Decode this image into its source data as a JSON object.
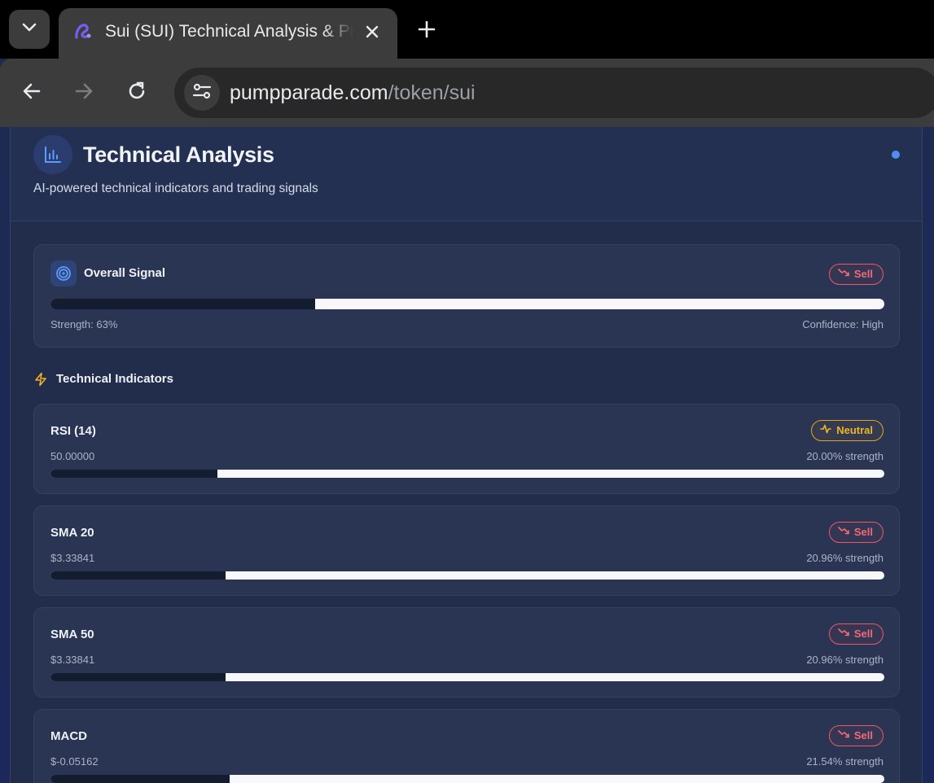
{
  "browser": {
    "tab_title": "Sui (SUI) Technical Analysis & Price Prediction",
    "url_domain": "pumpparade.com",
    "url_path": "/token/sui"
  },
  "panel": {
    "title": "Technical Analysis",
    "subtitle": "AI-powered technical indicators and trading signals"
  },
  "overall_signal": {
    "title": "Overall Signal",
    "signal": "Sell",
    "strength_label": "Strength: 63%",
    "confidence_label": "Confidence: High",
    "bar_dark_fraction": 0.317
  },
  "indicators_section": {
    "title": "Technical Indicators"
  },
  "indicators": [
    {
      "name": "RSI (14)",
      "value": "50.00000",
      "strength": "20.00% strength",
      "signal": "Neutral",
      "type": "neutral",
      "bar_dark_fraction": 0.2
    },
    {
      "name": "SMA 20",
      "value": "$3.33841",
      "strength": "20.96% strength",
      "signal": "Sell",
      "type": "sell",
      "bar_dark_fraction": 0.21
    },
    {
      "name": "SMA 50",
      "value": "$3.33841",
      "strength": "20.96% strength",
      "signal": "Sell",
      "type": "sell",
      "bar_dark_fraction": 0.21
    },
    {
      "name": "MACD",
      "value": "$-0.05162",
      "strength": "21.54% strength",
      "signal": "Sell",
      "type": "sell",
      "bar_dark_fraction": 0.215
    }
  ],
  "colors": {
    "sell": "#f06b76",
    "neutral": "#f0b429",
    "accent": "#4f8df0",
    "panel_bg": "#222d4b"
  }
}
